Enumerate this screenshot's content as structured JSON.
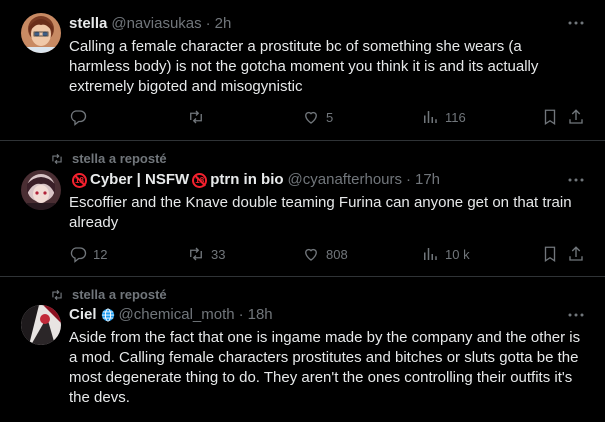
{
  "tweets": [
    {
      "name": "stella",
      "handle": "@naviasukas",
      "time": "2h",
      "text": "Calling a female character a prostitute bc of something she wears (a harmless body) is not the gotcha moment you think it is and its actually extremely bigoted and misogynistic",
      "counts": {
        "reply": "",
        "retweet": "",
        "like": "5",
        "views": "116"
      }
    },
    {
      "repost_label": "stella a reposté",
      "name": "Cyber | NSFW",
      "name_suffix": "ptrn in bio",
      "handle": "@cyanafterhours",
      "time": "17h",
      "text": "Escoffier and the Knave double teaming Furina can anyone get on that train already",
      "counts": {
        "reply": "12",
        "retweet": "33",
        "like": "808",
        "views": "10 k"
      }
    },
    {
      "repost_label": "stella a reposté",
      "name": "Ciel",
      "handle": "@chemical_moth",
      "time": "18h",
      "text": "Aside from the fact that one is ingame made by the company and the other is a mod. Calling female characters prostitutes and bitches or sluts gotta be the most degenerate thing to do. They aren't the ones controlling their outfits it's the devs."
    }
  ],
  "separator": "·",
  "colors": {
    "background": "#000000",
    "text": "#e7e9ea",
    "muted": "#71767b",
    "border": "#2f3336",
    "badge_red": "#f4212e"
  },
  "icons": [
    "reply-icon",
    "retweet-icon",
    "like-icon",
    "views-icon",
    "bookmark-icon",
    "share-icon",
    "more-icon",
    "no-under-18-icon",
    "globe-icon"
  ]
}
